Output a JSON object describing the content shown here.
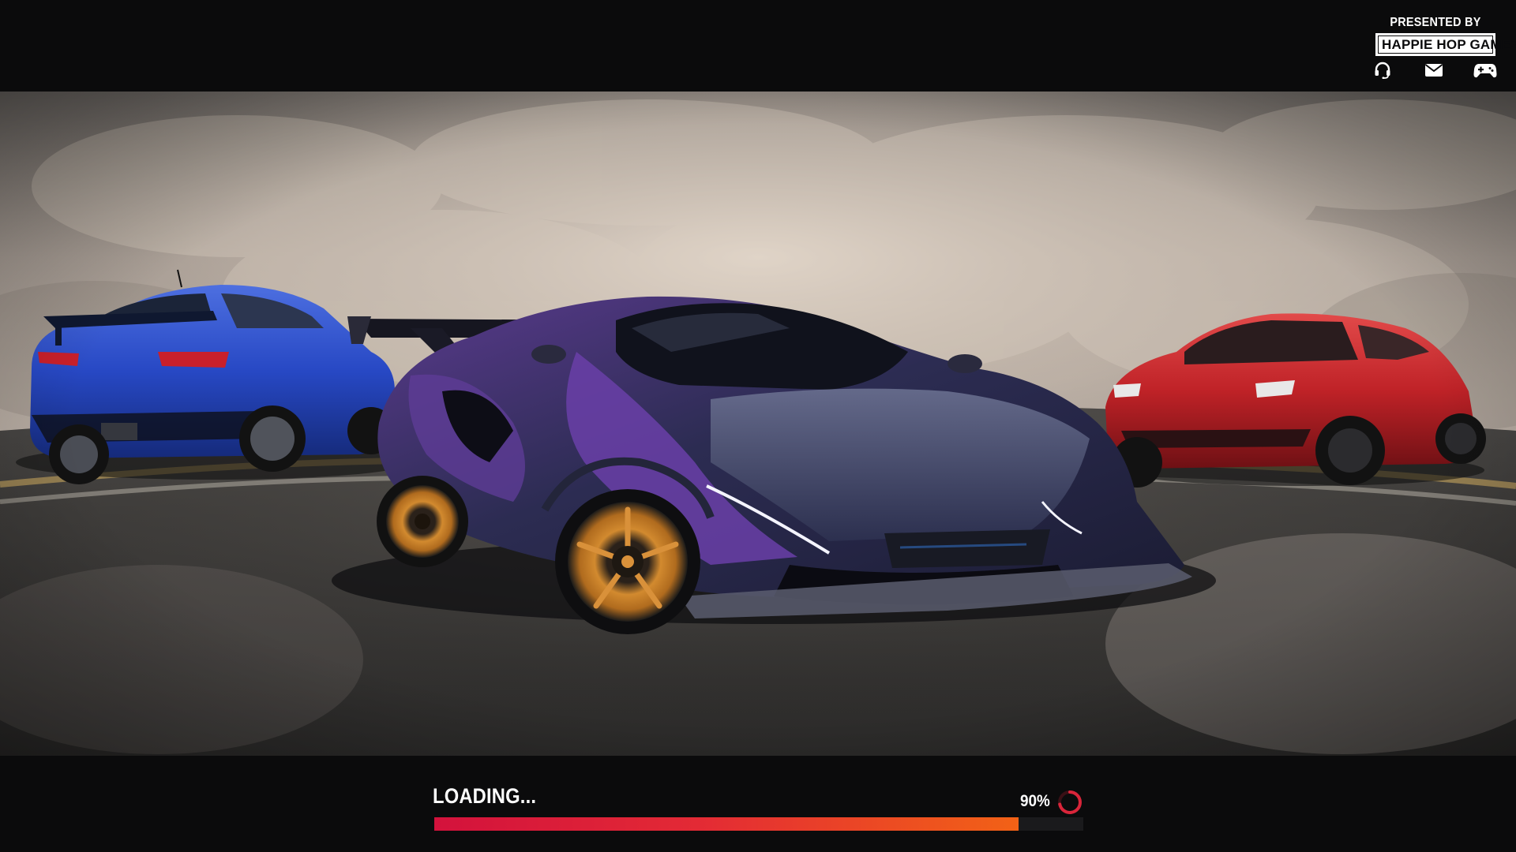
{
  "header": {
    "presented_by": "PRESENTED BY",
    "studio_name": "HAPPIE HOP GAMEZ",
    "icons": [
      "headset-icon",
      "mail-icon",
      "gamepad-icon"
    ]
  },
  "scene": {
    "cars": [
      "blue-sedan",
      "purple-hypercar",
      "red-sports-sedan"
    ]
  },
  "loading": {
    "label": "LOADING...",
    "progress_text": "90%",
    "progress_fraction": 0.9,
    "colors": {
      "bar_start": "#d3123c",
      "bar_end": "#f26216",
      "spinner": "#d9253a"
    }
  }
}
